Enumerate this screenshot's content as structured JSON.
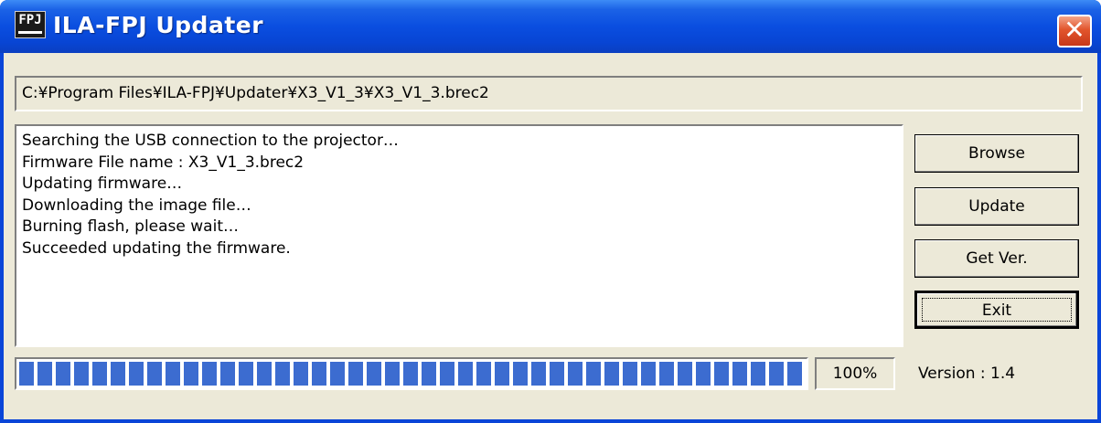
{
  "window": {
    "title": "ILA-FPJ Updater",
    "icon_text": "FPJ",
    "close_label": "✕"
  },
  "path": {
    "value": "C:¥Program Files¥ILA-FPJ¥Updater¥X3_V1_3¥X3_V1_3.brec2"
  },
  "log": {
    "lines": [
      "Searching the USB connection to the projector…",
      "Firmware File name : X3_V1_3.brec2",
      "Updating firmware…",
      "Downloading the image file…",
      "Burning flash, please wait…",
      "Succeeded updating the firmware."
    ]
  },
  "buttons": {
    "browse": "Browse",
    "update": "Update",
    "get_ver": "Get Ver.",
    "exit": "Exit"
  },
  "progress": {
    "value": 1.0,
    "label": "100%"
  },
  "version": {
    "label": "Version : 1.4"
  },
  "colors": {
    "titlebar": "#0a4ee0",
    "progress_block": "#3c6cd0",
    "face": "#ece9d8",
    "close": "#e2552c"
  }
}
